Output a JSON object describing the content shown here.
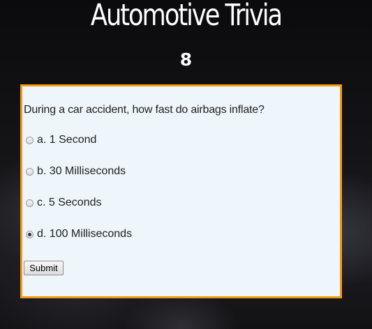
{
  "header": {
    "title": "Automotive Trivia",
    "question_number": "8"
  },
  "quiz": {
    "question": "During a car accident, how fast do airbags inflate?",
    "options": [
      {
        "label": "a. 1 Second",
        "selected": false
      },
      {
        "label": "b. 30 Milliseconds",
        "selected": false
      },
      {
        "label": "c. 5 Seconds",
        "selected": false
      },
      {
        "label": "d. 100 Milliseconds",
        "selected": true
      }
    ],
    "submit_label": "Submit"
  },
  "colors": {
    "panel_border": "#f29a12",
    "panel_background": "#eef6fb",
    "title_text": "#ffffff"
  }
}
